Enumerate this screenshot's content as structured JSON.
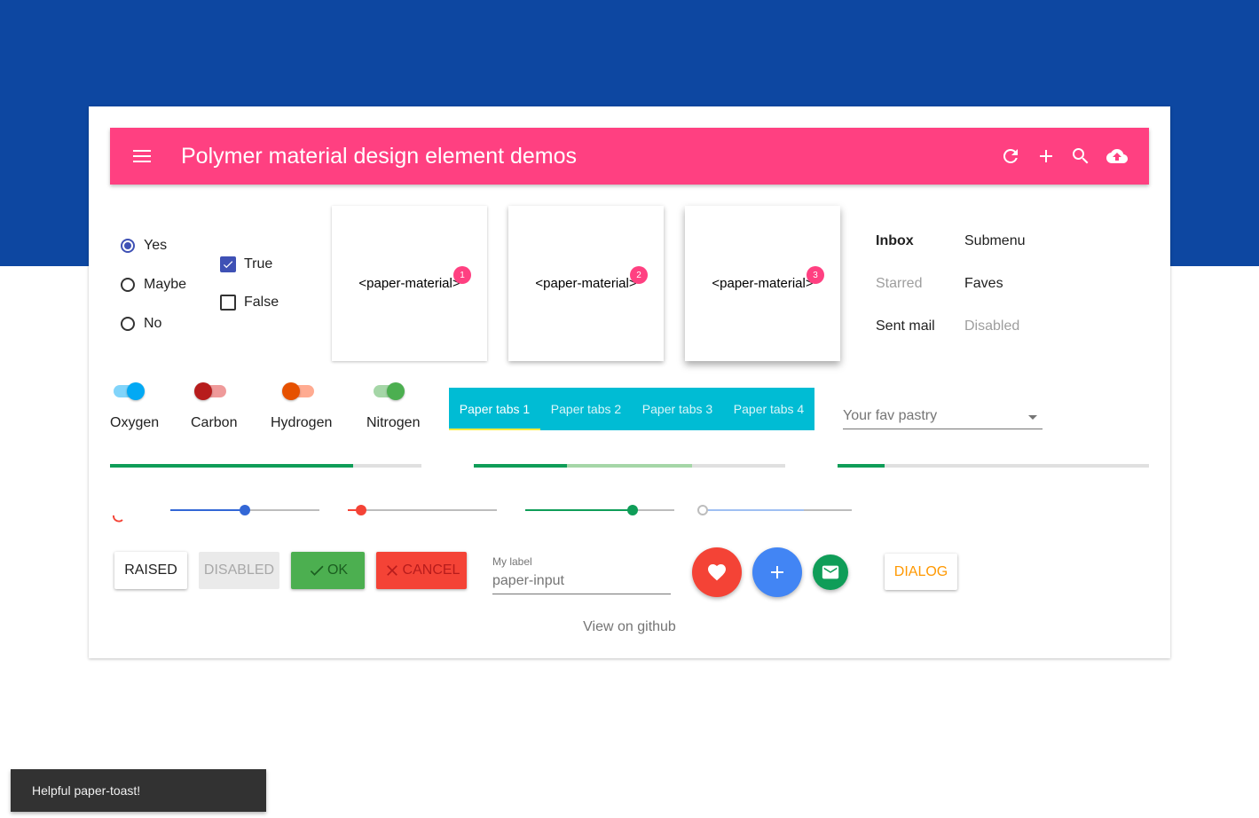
{
  "toolbar": {
    "title": "Polymer material design element demos"
  },
  "radios": [
    {
      "label": "Yes",
      "checked": true
    },
    {
      "label": "Maybe",
      "checked": false
    },
    {
      "label": "No",
      "checked": false
    }
  ],
  "checkboxes": [
    {
      "label": "True",
      "checked": true
    },
    {
      "label": "False",
      "checked": false
    }
  ],
  "paper_materials": [
    {
      "label": "<paper-material>",
      "badge": "1"
    },
    {
      "label": "<paper-material>",
      "badge": "2"
    },
    {
      "label": "<paper-material>",
      "badge": "3"
    }
  ],
  "menu": {
    "col1": [
      "Inbox",
      "Starred",
      "Sent mail"
    ],
    "col2": [
      "Submenu",
      "Faves",
      "Disabled"
    ]
  },
  "toggles": [
    {
      "label": "Oxygen",
      "on": true
    },
    {
      "label": "Carbon",
      "on": false
    },
    {
      "label": "Hydrogen",
      "on": false
    },
    {
      "label": "Nitrogen",
      "on": true
    }
  ],
  "tabs": [
    "Paper tabs 1",
    "Paper tabs 2",
    "Paper tabs 3",
    "Paper tabs 4"
  ],
  "dropdown": {
    "placeholder": "Your fav pastry"
  },
  "progress": [
    {
      "value": 0.78,
      "secondary": 0
    },
    {
      "value": 0.3,
      "secondary": 0.7
    },
    {
      "value": 0.15,
      "secondary": 0
    }
  ],
  "sliders": [
    {
      "value": 0.5,
      "color": "#3367d6"
    },
    {
      "value": 0.09,
      "color": "#f44336"
    },
    {
      "value": 0.72,
      "color": "#0f9d58"
    },
    {
      "value": 0.0,
      "secondary": 0.68,
      "color": "#3367d6"
    }
  ],
  "buttons": {
    "raised": "RAISED",
    "disabled": "DISABLED",
    "ok": "OK",
    "cancel": "CANCEL",
    "dialog": "DIALOG"
  },
  "input": {
    "label": "My label",
    "placeholder": "paper-input"
  },
  "github": "View on github",
  "toast": "Helpful paper-toast!",
  "colors": {
    "header_bg": "#0d47a1",
    "toolbar": "#ff4081",
    "tabs": "#00bcd4",
    "ok": "#4caf50",
    "cancel": "#f44336",
    "fab_red": "#f44336",
    "fab_blue": "#4285f4",
    "fab_green": "#0f9d58",
    "dialog": "#ff9800"
  }
}
